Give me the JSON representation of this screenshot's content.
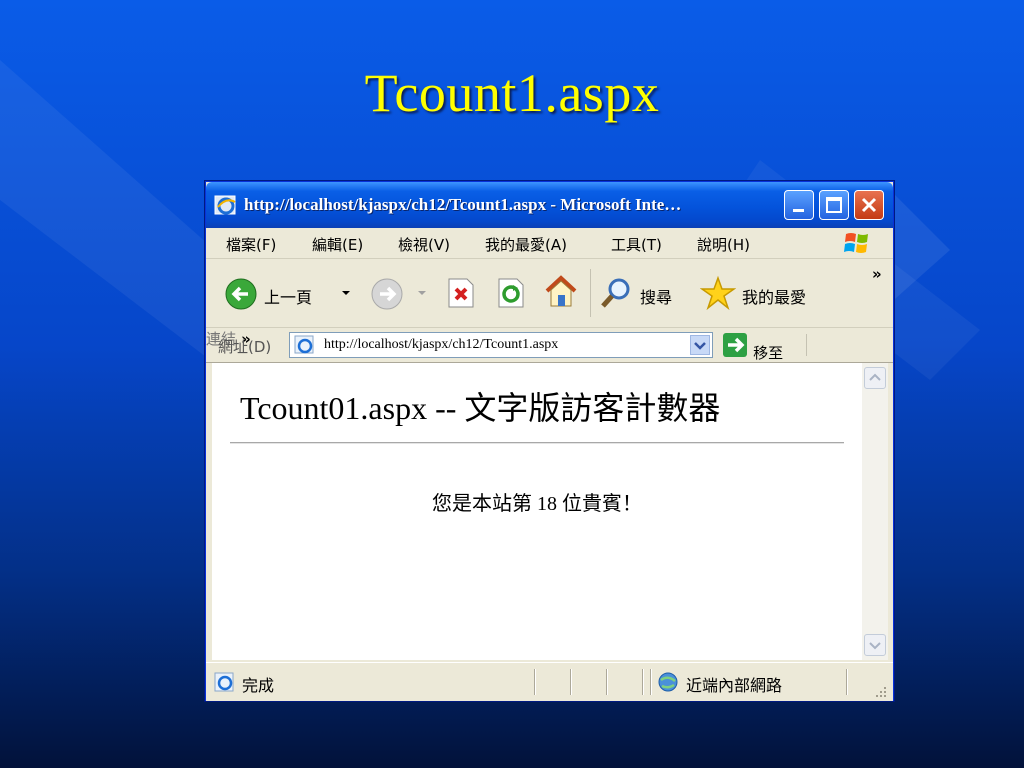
{
  "slide": {
    "title": "Tcount1.aspx"
  },
  "window": {
    "title": "http://localhost/kjaspx/ch12/Tcount1.aspx - Microsoft Inte…"
  },
  "menu": {
    "items": [
      "檔案(F)",
      "編輯(E)",
      "檢視(V)",
      "我的最愛(A)",
      "工具(T)",
      "說明(H)"
    ]
  },
  "toolbar": {
    "back_label": "上一頁",
    "search_label": "搜尋",
    "favorites_label": "我的最愛",
    "overflow": "»"
  },
  "address": {
    "label": "網址(D)",
    "url": "http://localhost/kjaspx/ch12/Tcount1.aspx",
    "go_label": "移至",
    "links_label": "連結",
    "overflow": "»"
  },
  "page": {
    "heading": "Tcount01.aspx -- 文字版訪客計數器",
    "message": "您是本站第 18 位貴賓！"
  },
  "status": {
    "text": "完成",
    "zone": "近端內部網路"
  },
  "colors": {
    "background_top": "#0a5ce8",
    "background_bottom": "#02123a",
    "title_color": "#ffff00",
    "titlebar": "#0453db"
  }
}
